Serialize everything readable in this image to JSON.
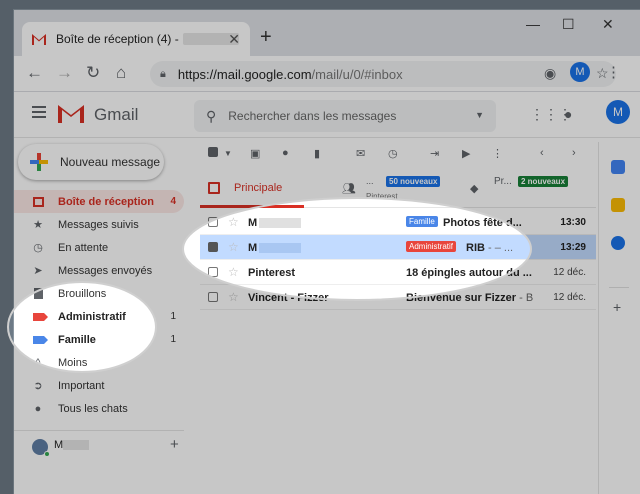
{
  "browser": {
    "tab_title": "Boîte de réception (4) -",
    "tab_close": "✕",
    "new_tab": "+",
    "url_host": "https://mail.google.com",
    "url_path": "/mail/u/0/#inbox",
    "avatar_letter": "M"
  },
  "header": {
    "app_name": "Gmail",
    "search_placeholder": "Rechercher dans les messages",
    "avatar_letter": "M"
  },
  "sidebar": {
    "compose_label": "Nouveau message",
    "items": [
      {
        "label": "Boîte de réception",
        "count": "4",
        "icon": "inbox-icon",
        "active": true
      },
      {
        "label": "Messages suivis",
        "count": "",
        "icon": "star-icon"
      },
      {
        "label": "En attente",
        "count": "",
        "icon": "clock-icon"
      },
      {
        "label": "Messages envoyés",
        "count": "",
        "icon": "send-icon"
      },
      {
        "label": "Brouillons",
        "count": "",
        "icon": "draft-icon"
      },
      {
        "label": "Administratif",
        "count": "1",
        "icon": "label-icon",
        "color": "#e8453c"
      },
      {
        "label": "Famille",
        "count": "1",
        "icon": "label-icon",
        "color": "#4a86e8"
      },
      {
        "label": "Moins",
        "count": "",
        "icon": "chevron-up-icon"
      },
      {
        "label": "Important",
        "count": "",
        "icon": "important-icon"
      },
      {
        "label": "Tous les chats",
        "count": "",
        "icon": "chat-icon"
      }
    ],
    "add_user": "+"
  },
  "tabs": {
    "principal": "Principale",
    "social_badge": "50 nouveaux",
    "social_sub": "Pinterest",
    "promo_label": "Pr...",
    "promo_badge": "2 nouveaux"
  },
  "emails": [
    {
      "sender": "M",
      "label": "Famille",
      "label_color": "#4a86e8",
      "subject": "Photos fête d...",
      "snippet": "",
      "time": "13:30",
      "selected": false,
      "unread": true
    },
    {
      "sender": "M",
      "label": "Administratif",
      "label_color": "#e8453c",
      "subject": "RIB",
      "snippet": " - – ...",
      "time": "13:29",
      "selected": true,
      "unread": true
    },
    {
      "sender": "Pinterest",
      "label": "",
      "subject": "18 épingles autour du ...",
      "snippet": "",
      "time": "12 déc.",
      "selected": false,
      "unread": false
    },
    {
      "sender": "Vincent - Fizzer",
      "label": "",
      "subject": "Bienvenue sur Fizzer",
      "snippet": " - B",
      "time": "12 déc.",
      "selected": false,
      "unread": false
    }
  ],
  "colors": {
    "accent_red": "#d93025",
    "selected_row": "#c2dbff",
    "social_badge": "#1a73e8",
    "promo_badge": "#188038"
  }
}
